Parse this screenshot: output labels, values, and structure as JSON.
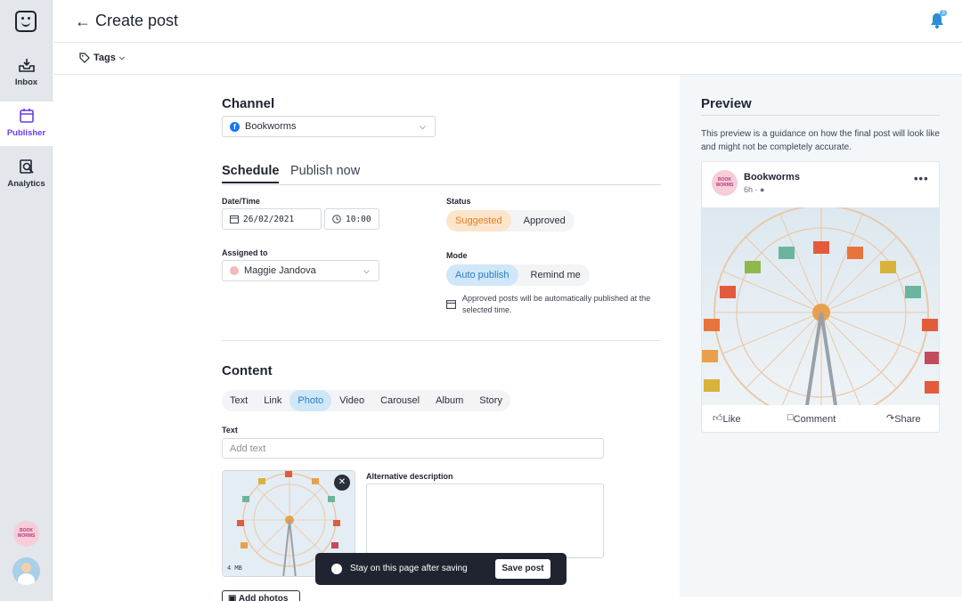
{
  "header": {
    "title": "Create post",
    "notification_count": "3"
  },
  "subbar": {
    "tags_label": "Tags"
  },
  "sidebar": {
    "items": [
      {
        "label": "Inbox",
        "icon": "inbox-icon"
      },
      {
        "label": "Publisher",
        "icon": "calendar-icon"
      },
      {
        "label": "Analytics",
        "icon": "analytics-icon"
      }
    ],
    "brand_avatar_text": "BOOK WORMS",
    "accent_color": "#6a3de8"
  },
  "channel": {
    "heading": "Channel",
    "selected": "Bookworms"
  },
  "schedule": {
    "tabs": [
      "Schedule",
      "Publish now"
    ],
    "date_label": "Date/Time",
    "date": "26/02/2021",
    "time": "10:00",
    "assigned_label": "Assigned to",
    "assignee": "Maggie Jandova",
    "status_label": "Status",
    "status_options": [
      "Suggested",
      "Approved"
    ],
    "mode_label": "Mode",
    "mode_options": [
      "Auto publish",
      "Remind me"
    ],
    "mode_hint": "Approved posts will be automatically published at the selected time."
  },
  "content": {
    "heading": "Content",
    "types": [
      "Text",
      "Link",
      "Photo",
      "Video",
      "Carousel",
      "Album",
      "Story"
    ],
    "selected_type": "Photo",
    "text_label": "Text",
    "text_placeholder": "Add text",
    "photo_size": "4 MB",
    "alt_label": "Alternative description",
    "add_photos_label": "Add photos"
  },
  "toast": {
    "text": "Stay on this page after saving",
    "save_label": "Save post"
  },
  "preview": {
    "heading": "Preview",
    "description": "This preview is a guidance on how the final post will look like and might not be completely accurate.",
    "page_name": "Bookworms",
    "post_time": "6h ·",
    "actions": [
      "Like",
      "Comment",
      "Share"
    ]
  }
}
